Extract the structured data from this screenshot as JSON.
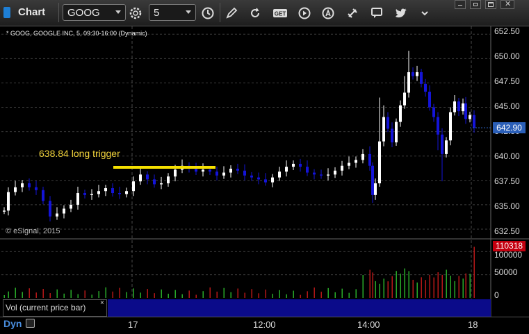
{
  "toolbar": {
    "app_title": "Chart",
    "symbol_value": "GOOG",
    "interval_value": "5",
    "icons": [
      "gear-icon",
      "clock-icon",
      "pencil-icon",
      "refresh-icon",
      "get-icon",
      "play-icon",
      "a-icon",
      "link-icon",
      "comment-icon",
      "twitter-icon",
      "dropdown-icon"
    ]
  },
  "legend": "* GOOG, GOOGLE INC, 5, 09:30-16:00 (Dynamic)",
  "annotation": "638.84 long trigger",
  "copyright": "© eSignal, 2015",
  "price_axis": {
    "ticks": [
      "652.50",
      "650.00",
      "647.50",
      "645.00",
      "642.50",
      "640.00",
      "637.50",
      "635.00",
      "632.50"
    ],
    "current_price": "642.90"
  },
  "volume_axis": {
    "ticks": [
      "100000",
      "50000",
      "0"
    ],
    "current_volume": "110318"
  },
  "volume_label": "Vol (current price bar)",
  "volume_close": "×",
  "time_axis": {
    "labels": [
      "17",
      "12:00",
      "14:00",
      "18"
    ]
  },
  "status": {
    "dyn_label": "Dyn"
  },
  "chart_data": {
    "type": "candlestick",
    "symbol": "GOOG",
    "yrange": [
      631.5,
      653.3
    ],
    "trigger_level": 638.84,
    "candle_colors": {
      "up": "#ffffff",
      "down": "#1414d8"
    },
    "volume_colors": {
      "up": "#2db82d",
      "down": "#c41a1a"
    },
    "volume_ymax": 120000
  }
}
